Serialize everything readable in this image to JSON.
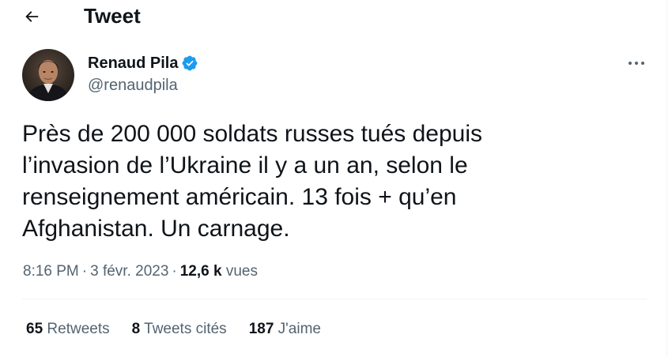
{
  "header": {
    "title": "Tweet"
  },
  "author": {
    "name": "Renaud Pila",
    "handle": "@renaudpila",
    "verified_color": "#1d9bf0"
  },
  "tweet": {
    "lines": [
      "Près de 200 000 soldats russes tués depuis",
      "l’invasion de l’Ukraine il y a un an, selon le",
      "renseignement américain. 13 fois + qu’en",
      "Afghanistan. Un carnage."
    ]
  },
  "meta": {
    "time": "8:16 PM",
    "separator": "·",
    "date": "3 févr. 2023",
    "views_count": "12,6 k",
    "views_label": "vues"
  },
  "stats": {
    "retweets_count": "65",
    "retweets_label": "Retweets",
    "quotes_count": "8",
    "quotes_label": "Tweets cités",
    "likes_count": "187",
    "likes_label": "J'aime"
  }
}
